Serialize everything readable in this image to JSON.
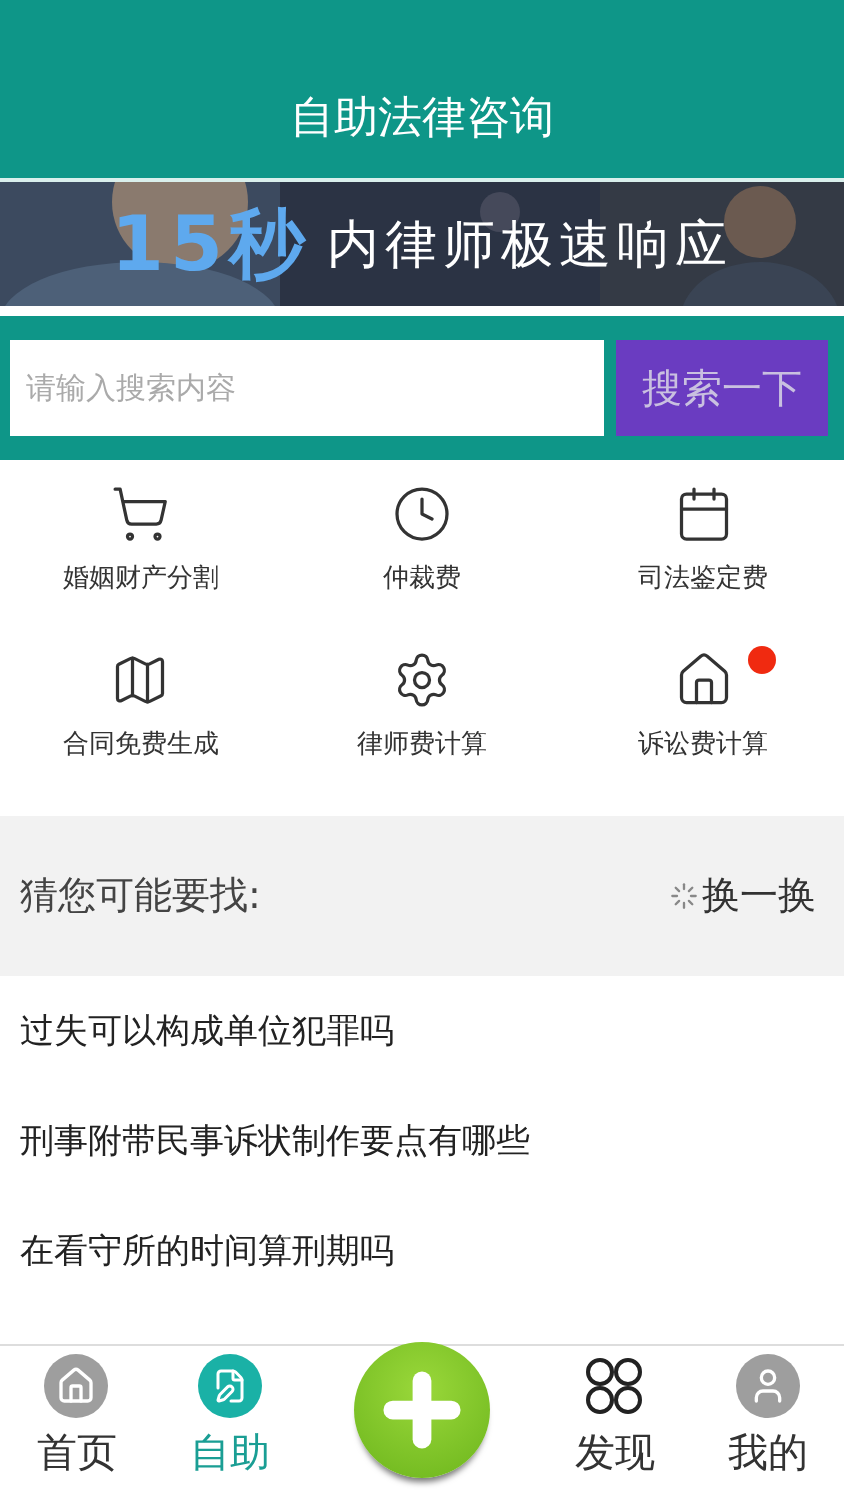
{
  "header": {
    "title": "自助法律咨询"
  },
  "banner": {
    "highlight": "15秒",
    "text": "内律师极速响应"
  },
  "search": {
    "placeholder": "请输入搜索内容",
    "button": "搜索一下"
  },
  "services": [
    {
      "label": "婚姻财产分割",
      "badge": false
    },
    {
      "label": "仲裁费",
      "badge": false
    },
    {
      "label": "司法鉴定费",
      "badge": false
    },
    {
      "label": "合同免费生成",
      "badge": false
    },
    {
      "label": "律师费计算",
      "badge": false
    },
    {
      "label": "诉讼费计算",
      "badge": true
    }
  ],
  "suggest": {
    "title": "猜您可能要找:",
    "refresh": "换一换"
  },
  "questions": [
    "过失可以构成单位犯罪吗",
    "刑事附带民事诉状制作要点有哪些",
    "在看守所的时间算刑期吗"
  ],
  "tabs": [
    {
      "kind": "home",
      "label": "首页",
      "selected": false
    },
    {
      "kind": "self",
      "label": "自助",
      "selected": true
    },
    {
      "kind": "plus"
    },
    {
      "kind": "discover",
      "label": "发现",
      "selected": false
    },
    {
      "kind": "me",
      "label": "我的",
      "selected": false
    }
  ]
}
